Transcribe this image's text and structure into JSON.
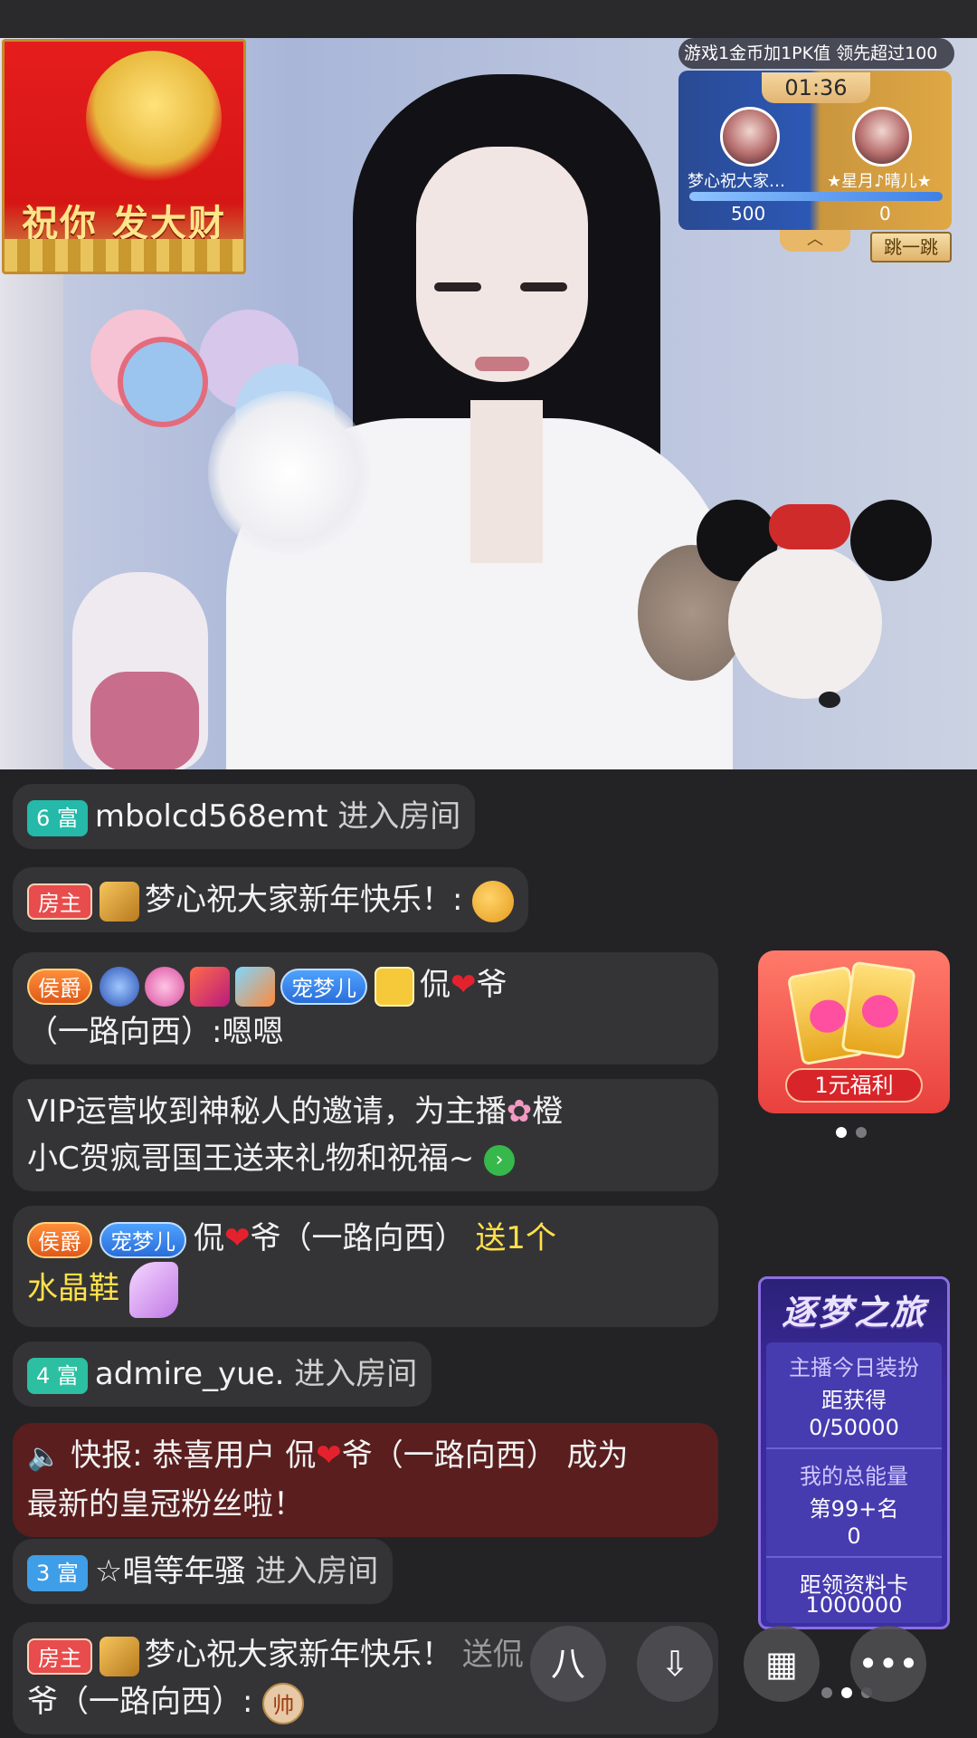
{
  "pk": {
    "banner": "游戏1金币加1PK值   领先超过100",
    "timer": "01:36",
    "left_name": "梦心祝大家…",
    "right_name": "★星月♪晴儿★",
    "left_score": "500",
    "right_score": "0",
    "toggle": "︿",
    "jump_label": "跳一跳"
  },
  "fortune": {
    "text": "祝你 发大财"
  },
  "chat": [
    {
      "badge": "6 富",
      "user": "mbolcd568emt",
      "action": "进入房间"
    },
    {
      "badge": "房主",
      "user": "梦心祝大家新年快乐！:",
      "action": ""
    },
    {
      "badge": "侯爵",
      "pet": "宠梦儿",
      "user_a": "侃",
      "user_b": "爷",
      "user_c": "（一路向西）:",
      "content": "嗯嗯"
    },
    {
      "text_a": "VIP运营收到神秘人的邀请，为主播",
      "text_b": "橙",
      "text_c": "小C贺疯哥国王送来礼物和祝福~"
    },
    {
      "badge": "侯爵",
      "pet": "宠梦儿",
      "user_a": "侃",
      "user_b": "爷（一路向西）",
      "gift": "送1个",
      "gift_line2": "水晶鞋"
    },
    {
      "badge": "4 富",
      "user": "admire_yue.",
      "action": "进入房间"
    },
    {
      "news_a": "快报: 恭喜用户 侃",
      "news_b": "爷（一路向西） 成为",
      "news_c": "最新的皇冠粉丝啦！"
    },
    {
      "badge": "3 富",
      "user": "☆唱等年骚",
      "action": "进入房间"
    },
    {
      "badge": "房主",
      "user": "梦心祝大家新年快乐！",
      "trail": "送侃",
      "line2": "爷（一路向西）:",
      "coin": "帅"
    }
  ],
  "welfare": {
    "label": "1元福利"
  },
  "dream": {
    "title": "逐梦之旅",
    "line1": "主播今日装扮",
    "line2": "距获得",
    "line3": "0/50000",
    "line4": "我的总能量",
    "line5": "第99+名",
    "line6": "0",
    "line7": "距领资料卡",
    "line8": "1000000"
  },
  "fabs": {
    "share": "⼋",
    "download": "⇩",
    "grid": "▦",
    "more": "•••"
  },
  "colors": {
    "chat_bg": "#343437",
    "news_bg": "#5a1e1f",
    "gift_text": "#ffe14a",
    "app_bg": "#232326"
  }
}
